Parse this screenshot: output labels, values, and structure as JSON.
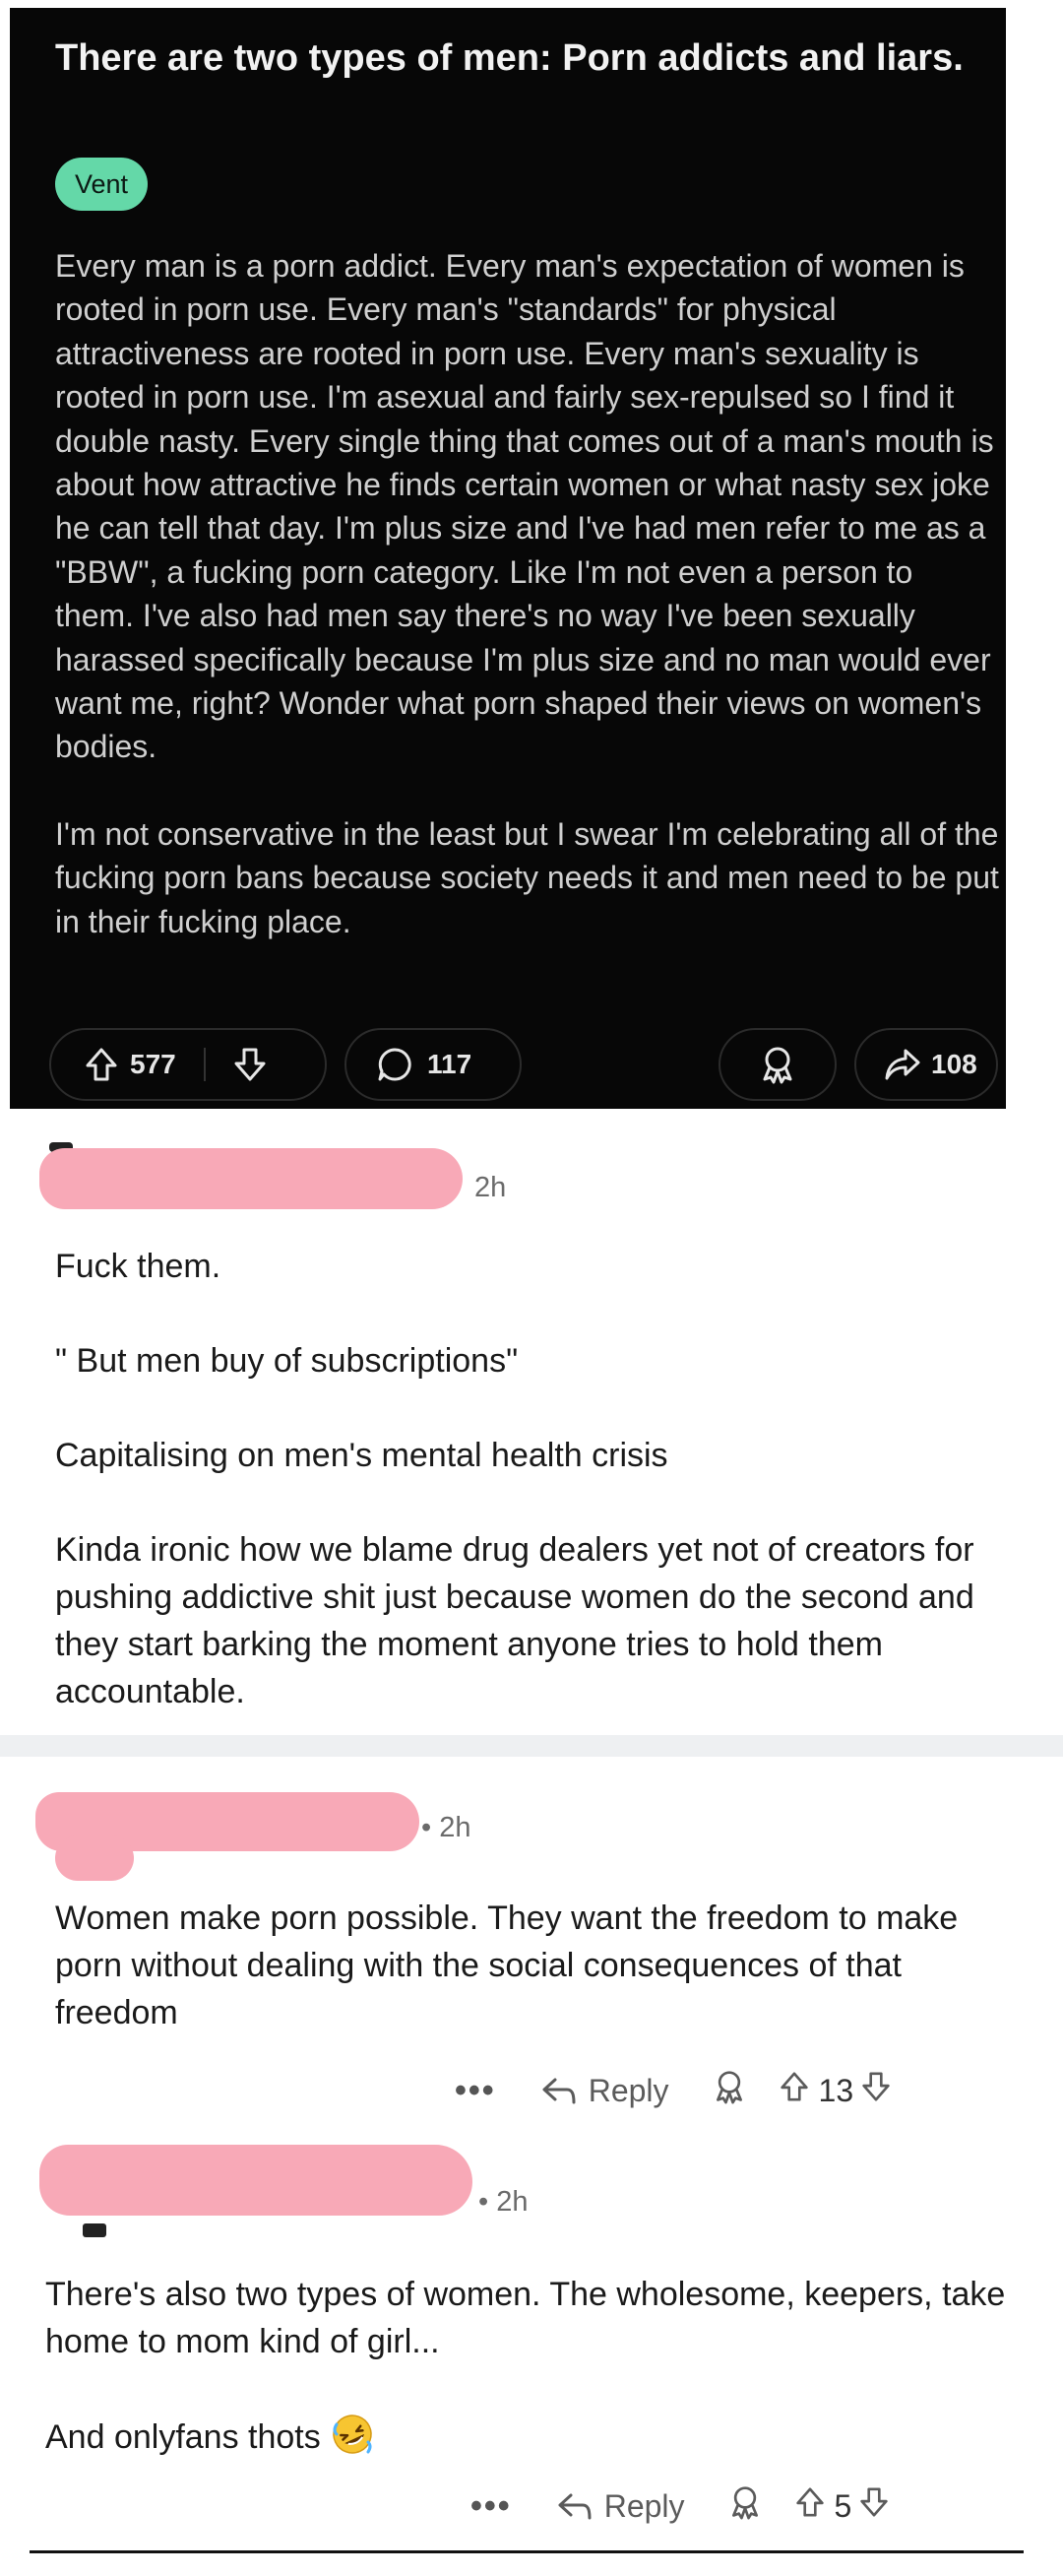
{
  "post": {
    "title": "There are two types of men: Porn addicts and liars.",
    "flair": "Vent",
    "paragraphs": [
      "Every man is a porn addict. Every man's expectation of women is rooted in porn use. Every man's \"standards\" for physical attractiveness are rooted in porn use. Every man's sexuality is rooted in porn use. I'm asexual and fairly sex-repulsed so I find it double nasty. Every single thing that comes out of a man's mouth is about how attractive he finds certain women or what nasty sex joke he can tell that day. I'm plus size and I've had men refer to me as a \"BBW\", a fucking porn category. Like I'm not even a person to them. I've also had men say there's no way I've been sexually harassed specifically because I'm plus size and no man would ever want me, right? Wonder what porn shaped their views on women's bodies.",
      "I'm not conservative in the least but I swear I'm celebrating all of the fucking porn bans because society needs it and men need to be put in their fucking place."
    ],
    "upvotes": "577",
    "comments": "117",
    "shares": "108"
  },
  "comments": [
    {
      "time": "2h",
      "paragraphs": [
        "Fuck them.",
        "\" But men buy of subscriptions\"",
        "Capitalising on men's mental health crisis",
        "Kinda ironic how we blame drug dealers yet not of creators for pushing addictive shit just because women do the second and they start barking the moment anyone tries to hold them accountable."
      ]
    },
    {
      "time": "• 2h",
      "paragraphs": [
        "Women make porn possible. They want the freedom to make porn without dealing with the social consequences of that freedom"
      ],
      "more": "•••",
      "reply_label": "Reply",
      "score": "13"
    },
    {
      "time": "• 2h",
      "paragraphs": [
        "There's also two types of women. The wholesome, keepers, take home to mom kind of girl...",
        "And onlyfans thots"
      ],
      "more": "•••",
      "reply_label": "Reply",
      "score": "5"
    }
  ],
  "icons": [
    "upvote-icon",
    "downvote-icon",
    "comment-bubble-icon",
    "award-icon",
    "share-icon",
    "reply-icon",
    "more-icon",
    "rofl-emoji"
  ]
}
